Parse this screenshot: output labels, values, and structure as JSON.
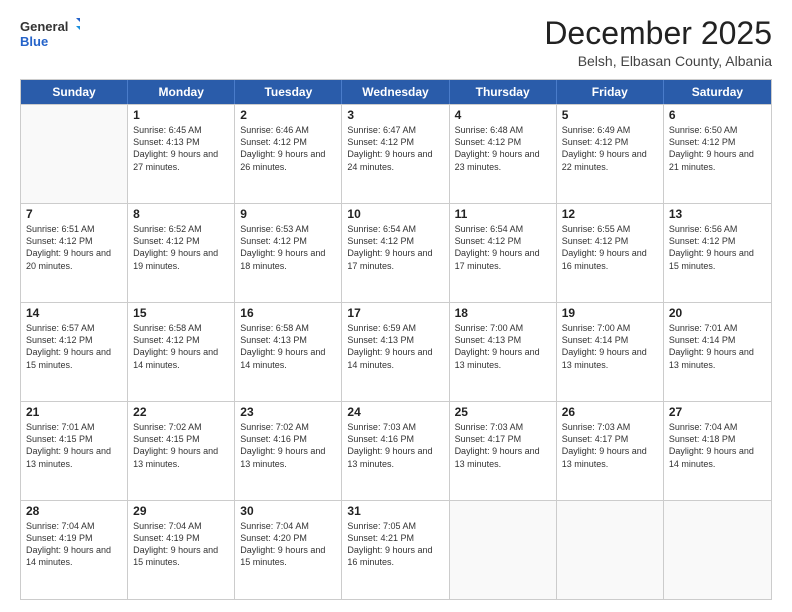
{
  "logo": {
    "general": "General",
    "blue": "Blue"
  },
  "header": {
    "month": "December 2025",
    "location": "Belsh, Elbasan County, Albania"
  },
  "days": [
    "Sunday",
    "Monday",
    "Tuesday",
    "Wednesday",
    "Thursday",
    "Friday",
    "Saturday"
  ],
  "weeks": [
    [
      {
        "day": null
      },
      {
        "day": 1,
        "sunrise": "6:45 AM",
        "sunset": "4:13 PM",
        "daylight": "9 hours and 27 minutes."
      },
      {
        "day": 2,
        "sunrise": "6:46 AM",
        "sunset": "4:12 PM",
        "daylight": "9 hours and 26 minutes."
      },
      {
        "day": 3,
        "sunrise": "6:47 AM",
        "sunset": "4:12 PM",
        "daylight": "9 hours and 24 minutes."
      },
      {
        "day": 4,
        "sunrise": "6:48 AM",
        "sunset": "4:12 PM",
        "daylight": "9 hours and 23 minutes."
      },
      {
        "day": 5,
        "sunrise": "6:49 AM",
        "sunset": "4:12 PM",
        "daylight": "9 hours and 22 minutes."
      },
      {
        "day": 6,
        "sunrise": "6:50 AM",
        "sunset": "4:12 PM",
        "daylight": "9 hours and 21 minutes."
      }
    ],
    [
      {
        "day": 7,
        "sunrise": "6:51 AM",
        "sunset": "4:12 PM",
        "daylight": "9 hours and 20 minutes."
      },
      {
        "day": 8,
        "sunrise": "6:52 AM",
        "sunset": "4:12 PM",
        "daylight": "9 hours and 19 minutes."
      },
      {
        "day": 9,
        "sunrise": "6:53 AM",
        "sunset": "4:12 PM",
        "daylight": "9 hours and 18 minutes."
      },
      {
        "day": 10,
        "sunrise": "6:54 AM",
        "sunset": "4:12 PM",
        "daylight": "9 hours and 17 minutes."
      },
      {
        "day": 11,
        "sunrise": "6:54 AM",
        "sunset": "4:12 PM",
        "daylight": "9 hours and 17 minutes."
      },
      {
        "day": 12,
        "sunrise": "6:55 AM",
        "sunset": "4:12 PM",
        "daylight": "9 hours and 16 minutes."
      },
      {
        "day": 13,
        "sunrise": "6:56 AM",
        "sunset": "4:12 PM",
        "daylight": "9 hours and 15 minutes."
      }
    ],
    [
      {
        "day": 14,
        "sunrise": "6:57 AM",
        "sunset": "4:12 PM",
        "daylight": "9 hours and 15 minutes."
      },
      {
        "day": 15,
        "sunrise": "6:58 AM",
        "sunset": "4:12 PM",
        "daylight": "9 hours and 14 minutes."
      },
      {
        "day": 16,
        "sunrise": "6:58 AM",
        "sunset": "4:13 PM",
        "daylight": "9 hours and 14 minutes."
      },
      {
        "day": 17,
        "sunrise": "6:59 AM",
        "sunset": "4:13 PM",
        "daylight": "9 hours and 14 minutes."
      },
      {
        "day": 18,
        "sunrise": "7:00 AM",
        "sunset": "4:13 PM",
        "daylight": "9 hours and 13 minutes."
      },
      {
        "day": 19,
        "sunrise": "7:00 AM",
        "sunset": "4:14 PM",
        "daylight": "9 hours and 13 minutes."
      },
      {
        "day": 20,
        "sunrise": "7:01 AM",
        "sunset": "4:14 PM",
        "daylight": "9 hours and 13 minutes."
      }
    ],
    [
      {
        "day": 21,
        "sunrise": "7:01 AM",
        "sunset": "4:15 PM",
        "daylight": "9 hours and 13 minutes."
      },
      {
        "day": 22,
        "sunrise": "7:02 AM",
        "sunset": "4:15 PM",
        "daylight": "9 hours and 13 minutes."
      },
      {
        "day": 23,
        "sunrise": "7:02 AM",
        "sunset": "4:16 PM",
        "daylight": "9 hours and 13 minutes."
      },
      {
        "day": 24,
        "sunrise": "7:03 AM",
        "sunset": "4:16 PM",
        "daylight": "9 hours and 13 minutes."
      },
      {
        "day": 25,
        "sunrise": "7:03 AM",
        "sunset": "4:17 PM",
        "daylight": "9 hours and 13 minutes."
      },
      {
        "day": 26,
        "sunrise": "7:03 AM",
        "sunset": "4:17 PM",
        "daylight": "9 hours and 13 minutes."
      },
      {
        "day": 27,
        "sunrise": "7:04 AM",
        "sunset": "4:18 PM",
        "daylight": "9 hours and 14 minutes."
      }
    ],
    [
      {
        "day": 28,
        "sunrise": "7:04 AM",
        "sunset": "4:19 PM",
        "daylight": "9 hours and 14 minutes."
      },
      {
        "day": 29,
        "sunrise": "7:04 AM",
        "sunset": "4:19 PM",
        "daylight": "9 hours and 15 minutes."
      },
      {
        "day": 30,
        "sunrise": "7:04 AM",
        "sunset": "4:20 PM",
        "daylight": "9 hours and 15 minutes."
      },
      {
        "day": 31,
        "sunrise": "7:05 AM",
        "sunset": "4:21 PM",
        "daylight": "9 hours and 16 minutes."
      },
      {
        "day": null
      },
      {
        "day": null
      },
      {
        "day": null
      }
    ]
  ]
}
